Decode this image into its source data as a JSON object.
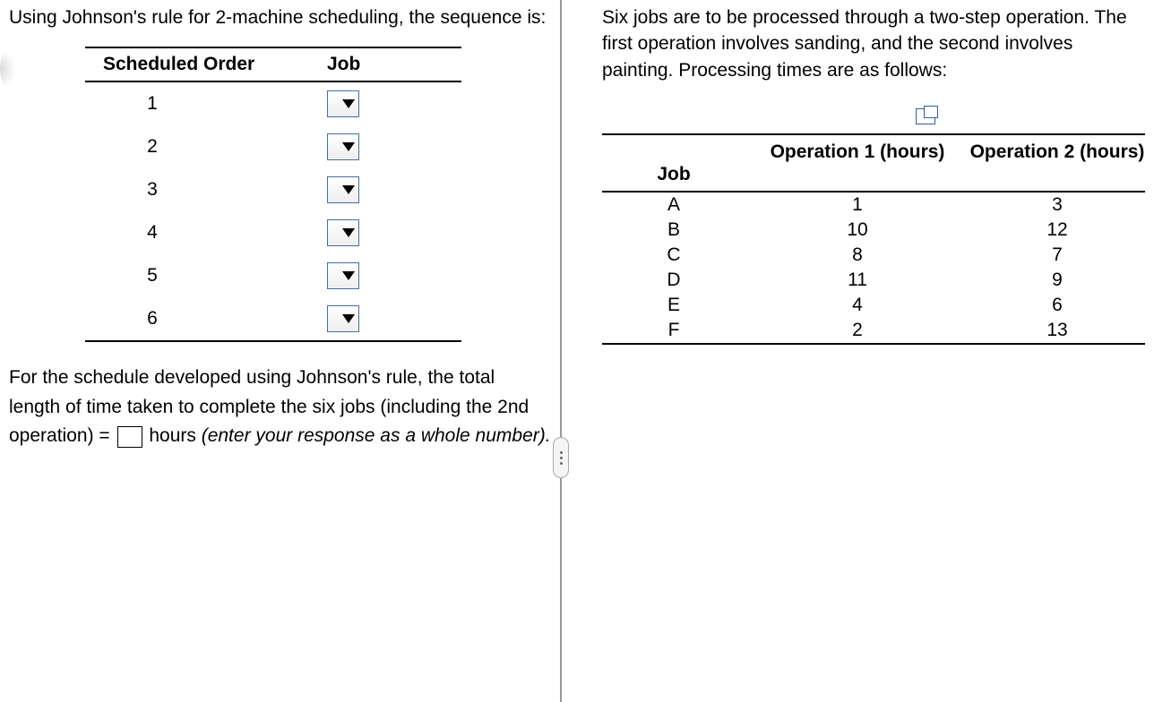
{
  "left": {
    "intro": "Using Johnson's rule for 2-machine scheduling, the sequence is:",
    "schedule_table": {
      "headers": {
        "order": "Scheduled Order",
        "job": "Job"
      },
      "rows": [
        {
          "order": "1",
          "job": ""
        },
        {
          "order": "2",
          "job": ""
        },
        {
          "order": "3",
          "job": ""
        },
        {
          "order": "4",
          "job": ""
        },
        {
          "order": "5",
          "job": ""
        },
        {
          "order": "6",
          "job": ""
        }
      ]
    },
    "post_text_1": "For the schedule developed using Johnson's rule, the total length of time taken to complete the six jobs (including the 2nd operation) = ",
    "post_hours": " hours ",
    "post_italic": "(enter your response as a whole number).",
    "total_time_value": ""
  },
  "right": {
    "intro": "Six jobs are to be processed through a two-step operation.  The first operation involves sanding, and the second involves painting. Processing times are as follows:",
    "data_table": {
      "headers": {
        "job": "Job",
        "op1": "Operation 1 (hours)",
        "op2": "Operation 2 (hours)"
      },
      "rows": [
        {
          "job": "A",
          "op1": "1",
          "op2": "3"
        },
        {
          "job": "B",
          "op1": "10",
          "op2": "12"
        },
        {
          "job": "C",
          "op1": "8",
          "op2": "7"
        },
        {
          "job": "D",
          "op1": "11",
          "op2": "9"
        },
        {
          "job": "E",
          "op1": "4",
          "op2": "6"
        },
        {
          "job": "F",
          "op1": "2",
          "op2": "13"
        }
      ]
    }
  }
}
